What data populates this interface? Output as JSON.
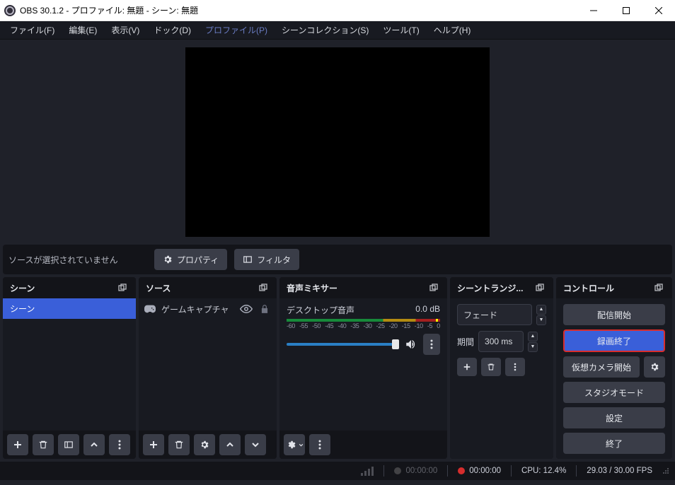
{
  "window": {
    "title": "OBS 30.1.2 - プロファイル: 無題 - シーン: 無題"
  },
  "menu": {
    "file": "ファイル(F)",
    "edit": "編集(E)",
    "view": "表示(V)",
    "dock": "ドック(D)",
    "profile": "プロファイル(P)",
    "sceneCollection": "シーンコレクション(S)",
    "tools": "ツール(T)",
    "help": "ヘルプ(H)"
  },
  "context": {
    "noSource": "ソースが選択されていません",
    "properties": "プロパティ",
    "filters": "フィルタ"
  },
  "docks": {
    "scenes": {
      "title": "シーン",
      "items": [
        "シーン"
      ]
    },
    "sources": {
      "title": "ソース",
      "items": [
        {
          "name": "ゲームキャプチャ"
        }
      ]
    },
    "mixer": {
      "title": "音声ミキサー",
      "channel": {
        "name": "デスクトップ音声",
        "level": "0.0 dB"
      },
      "ticks": [
        "-60",
        "-55",
        "-50",
        "-45",
        "-40",
        "-35",
        "-30",
        "-25",
        "-20",
        "-15",
        "-10",
        "-5",
        "0"
      ]
    },
    "transitions": {
      "title": "シーントランジ...",
      "selected": "フェード",
      "durationLabel": "期間",
      "duration": "300 ms"
    },
    "controls": {
      "title": "コントロール",
      "startStream": "配信開始",
      "stopRecord": "録画終了",
      "startCam": "仮想カメラ開始",
      "studio": "スタジオモード",
      "settings": "設定",
      "exit": "終了"
    }
  },
  "status": {
    "streamTime": "00:00:00",
    "recTime": "00:00:00",
    "cpu": "CPU: 12.4%",
    "fps": "29.03 / 30.00 FPS"
  }
}
